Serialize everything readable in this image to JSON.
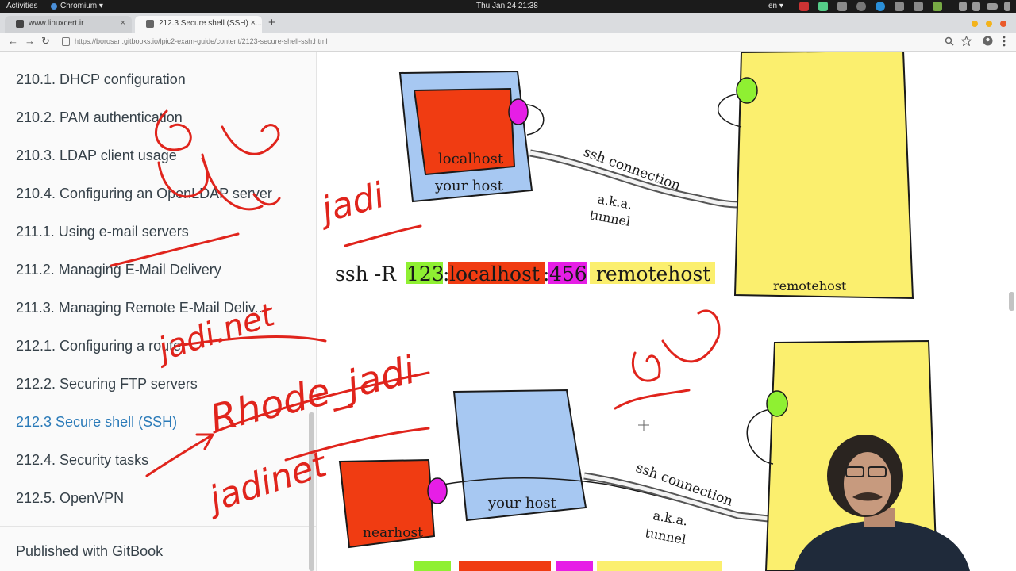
{
  "system": {
    "activities": "Activities",
    "app": "Chromium ▾",
    "clock": "Thu Jan 24  21:38",
    "lang": "en ▾"
  },
  "tabs": [
    {
      "title": "www.linuxcert.ir",
      "close": "×"
    },
    {
      "title": "212.3 Secure shell (SSH) · ...",
      "close": "×"
    }
  ],
  "new_tab": "+",
  "toolbar": {
    "back": "←",
    "forward": "→",
    "reload": "↻",
    "url": "https://borosan.gitbooks.io/lpic2-exam-guide/content/2123-secure-shell-ssh.html"
  },
  "sidebar": {
    "items": [
      {
        "label": "210.1. DHCP configuration"
      },
      {
        "label": "210.2. PAM authentication"
      },
      {
        "label": "210.3. LDAP client usage"
      },
      {
        "label": "210.4. Configuring an OpenLDAP server"
      },
      {
        "label": "211.1. Using e-mail servers"
      },
      {
        "label": "211.2. Managing E-Mail Delivery"
      },
      {
        "label": "211.3. Managing Remote E-Mail Deliv..."
      },
      {
        "label": "212.1. Configuring a router"
      },
      {
        "label": "212.2. Securing FTP servers"
      },
      {
        "label": "212.3 Secure shell (SSH)"
      },
      {
        "label": "212.4. Security tasks"
      },
      {
        "label": "212.5. OpenVPN"
      }
    ],
    "active_index": 9,
    "footer": "Published with GitBook"
  },
  "diagram1": {
    "localhost": "localhost",
    "your_host": "your host",
    "ssh_connection": "ssh connection",
    "aka": "a.k.a.",
    "tunnel": "tunnel",
    "remotehost": "remotehost",
    "cmd_prefix": "ssh -R ",
    "cmd_port1": "123",
    "cmd_sep1": ":",
    "cmd_host": "localhost",
    "cmd_sep2": ":",
    "cmd_port2": "456",
    "cmd_remote": " remotehost"
  },
  "diagram2": {
    "nearhost": "nearhost",
    "your_host": "your host",
    "ssh_connection": "ssh connection",
    "aka": "a.k.a.",
    "tunnel": "tunnel"
  },
  "annotations": {
    "jadi": "jadi",
    "jadi_net": "jadi.net",
    "rhode_jadi": "Rhode_jadi",
    "jadinet": "jadinet"
  },
  "colors": {
    "accent": "#2a7ab8",
    "green_port": "#8ff032",
    "red_host": "#f03c12",
    "magenta_port": "#e61ee6",
    "yellow_remote": "#fbef6e",
    "blue_host": "#a7c8f2",
    "ink": "#e0241c"
  }
}
